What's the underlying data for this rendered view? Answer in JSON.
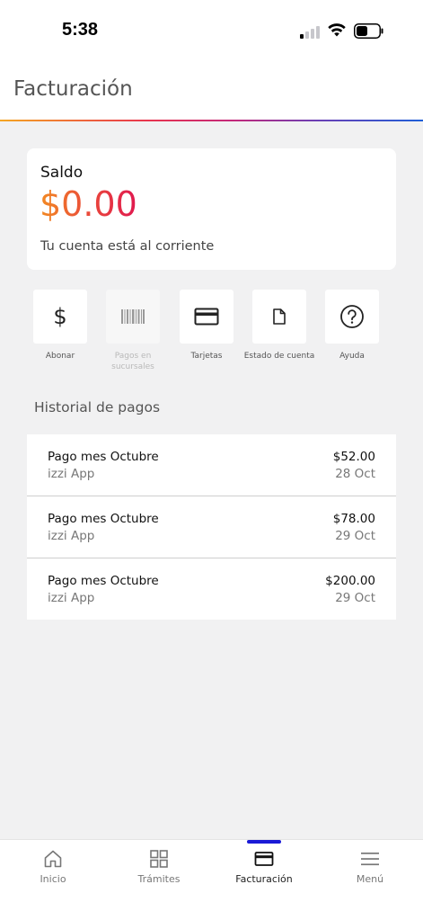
{
  "status_bar": {
    "time": "5:38"
  },
  "header": {
    "title": "Facturación"
  },
  "balance": {
    "label": "Saldo",
    "amount": "$0.00",
    "status": "Tu cuenta está al corriente"
  },
  "actions": [
    {
      "label": "Abonar",
      "icon": "dollar-icon",
      "enabled": true
    },
    {
      "label": "Pagos en sucursales",
      "icon": "barcode-icon",
      "enabled": false
    },
    {
      "label": "Tarjetas",
      "icon": "card-icon",
      "enabled": true
    },
    {
      "label": "Estado de cuenta",
      "icon": "document-icon",
      "enabled": true
    },
    {
      "label": "Ayuda",
      "icon": "help-icon",
      "enabled": true
    }
  ],
  "history": {
    "title": "Historial de pagos",
    "items": [
      {
        "title": "Pago mes Octubre",
        "source": "izzi App",
        "amount": "$52.00",
        "date": "28 Oct"
      },
      {
        "title": "Pago mes Octubre",
        "source": "izzi App",
        "amount": "$78.00",
        "date": "29 Oct"
      },
      {
        "title": "Pago mes Octubre",
        "source": "izzi App",
        "amount": "$200.00",
        "date": "29 Oct"
      }
    ]
  },
  "nav": {
    "items": [
      {
        "label": "Inicio",
        "icon": "home-icon"
      },
      {
        "label": "Trámites",
        "icon": "grid-icon"
      },
      {
        "label": "Facturación",
        "icon": "card-icon",
        "active": true
      },
      {
        "label": "Menú",
        "icon": "menu-icon"
      }
    ]
  },
  "colors": {
    "accent_nav": "#1a1ad6",
    "amount_gradient_start": "#f28a22",
    "amount_gradient_end": "#e0184f"
  }
}
